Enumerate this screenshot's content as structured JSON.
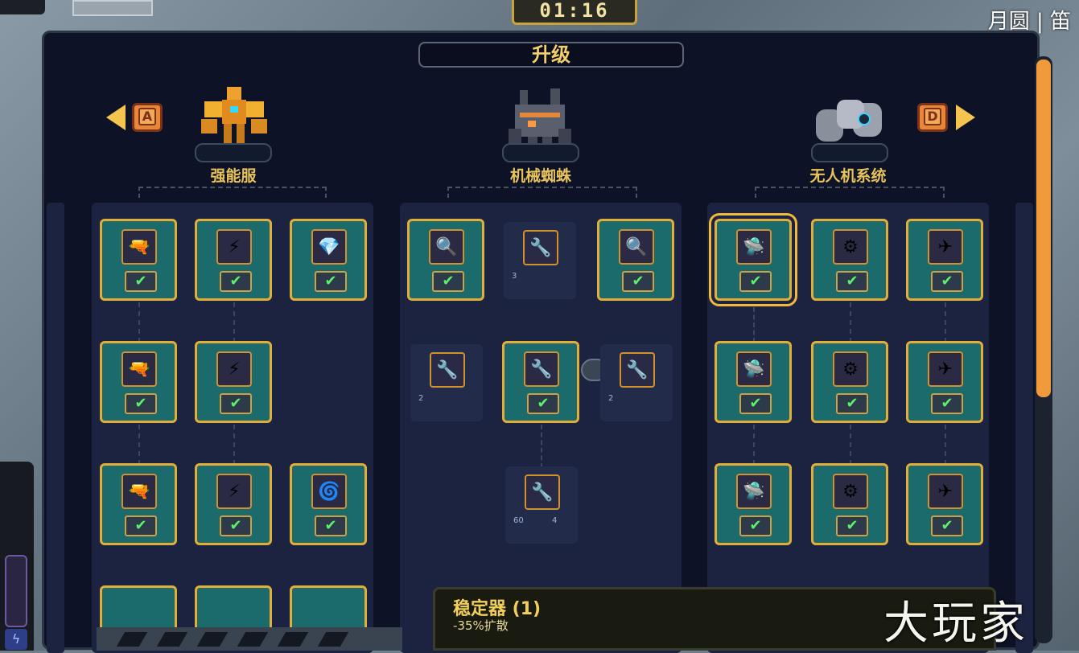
{
  "hud": {
    "timer": "01:16",
    "top_right": "月圆 | 笛"
  },
  "title": "升级",
  "nav": {
    "left_key": "A",
    "right_key": "D"
  },
  "characters": [
    {
      "label": "强能服",
      "icon": "orange-robot-icon"
    },
    {
      "label": "机械蜘蛛",
      "icon": "mech-spider-icon"
    },
    {
      "label": "无人机系统",
      "icon": "drone-icon"
    }
  ],
  "costs": {
    "spider_top_mid": "3",
    "spider_mid_left": "2",
    "spider_mid_right": "2",
    "spider_bottom_a": "60",
    "spider_bottom_b": "4"
  },
  "check_mark": "✔",
  "tooltip": {
    "title": "稳定器 (1)",
    "desc": "-35%扩散"
  },
  "watermark": "大玩家",
  "colors": {
    "accent": "#e3ad3a",
    "node_bg": "#1b6a6c",
    "panel_bg": "#0d1226",
    "scroll": "#f09a3c"
  }
}
